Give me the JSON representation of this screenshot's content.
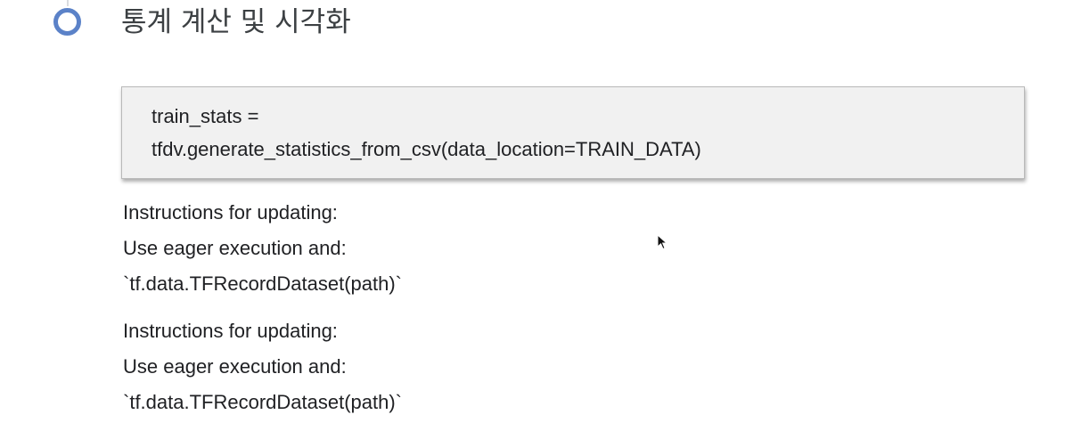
{
  "section": {
    "title": "통계 계산 및 시각화"
  },
  "code_cell": {
    "lines": [
      "train_stats =",
      "tfdv.generate_statistics_from_csv(data_location=TRAIN_DATA)"
    ]
  },
  "output": {
    "blocks": [
      {
        "lines": [
          "Instructions for updating:",
          "Use eager execution and:",
          "`tf.data.TFRecordDataset(path)`"
        ]
      },
      {
        "lines": [
          "Instructions for updating:",
          "Use eager execution and:",
          "`tf.data.TFRecordDataset(path)`"
        ]
      }
    ]
  },
  "icons": {
    "bullet": "circle-outline-icon",
    "cursor": "mouse-pointer-icon"
  },
  "colors": {
    "bullet_ring": "#5b82c8",
    "code_background": "#f1f1f1",
    "text": "#202124"
  }
}
